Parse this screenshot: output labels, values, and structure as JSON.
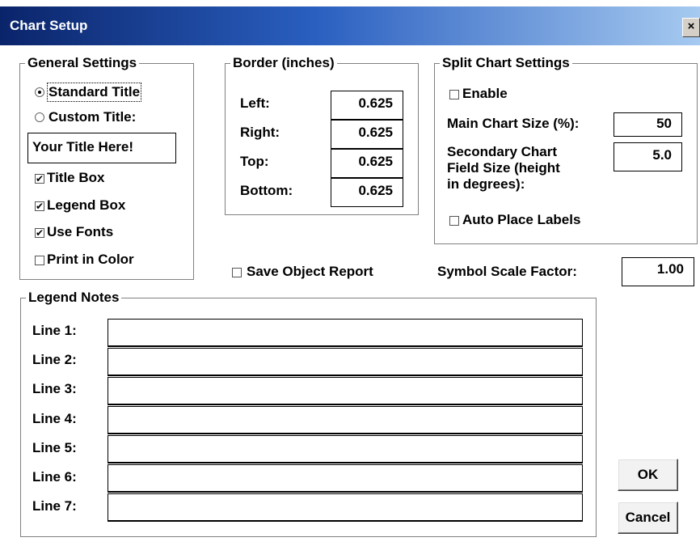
{
  "window": {
    "title": "Chart Setup",
    "close_glyph": "×"
  },
  "general": {
    "legend": "General Settings",
    "standard_title": "Standard Title",
    "custom_title": "Custom Title:",
    "title_value": "Your Title Here!",
    "title_box": "Title Box",
    "legend_box": "Legend Box",
    "use_fonts": "Use Fonts",
    "print_color": "Print in Color",
    "selected_title_mode": "Standard Title"
  },
  "border": {
    "legend": "Border (inches)",
    "left_label": "Left:",
    "left_value": "0.625",
    "right_label": "Right:",
    "right_value": "0.625",
    "top_label": "Top:",
    "top_value": "0.625",
    "bottom_label": "Bottom:",
    "bottom_value": "0.625"
  },
  "split": {
    "legend": "Split Chart Settings",
    "enable": "Enable",
    "main_size_label": "Main Chart Size (%):",
    "main_size_value": "50",
    "secondary_label_1": "Secondary Chart",
    "secondary_label_2": "Field Size (height",
    "secondary_label_3": "in degrees):",
    "secondary_value": "5.0",
    "auto_place": "Auto Place Labels"
  },
  "save_report": "Save Object Report",
  "symbol_scale_label": "Symbol Scale Factor:",
  "symbol_scale_value": "1.00",
  "legend_notes": {
    "legend": "Legend Notes",
    "lines": [
      "Line 1:",
      "Line 2:",
      "Line 3:",
      "Line 4:",
      "Line 5:",
      "Line 6:",
      "Line 7:"
    ]
  },
  "buttons": {
    "ok": "OK",
    "cancel": "Cancel"
  },
  "checkbox_states": {
    "title_box": true,
    "legend_box": true,
    "use_fonts": true,
    "print_color": false,
    "enable": false,
    "auto_place": false,
    "save_report": false
  },
  "check_glyph": "✔"
}
